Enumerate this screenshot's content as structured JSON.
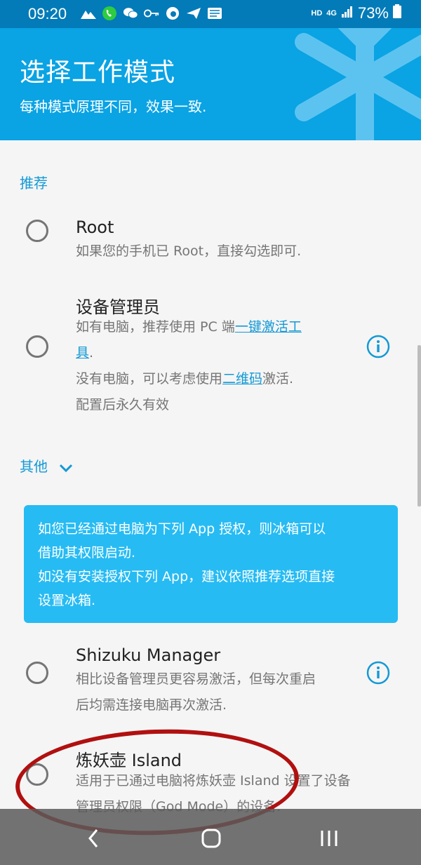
{
  "status_bar": {
    "time": "09:20",
    "hd": "HD",
    "network": "4G",
    "battery": "73%"
  },
  "header": {
    "title": "选择工作模式",
    "subtitle": "每种模式原理不同，效果一致."
  },
  "recommended": {
    "label": "推荐",
    "options": [
      {
        "title": "Root",
        "desc": "如果您的手机已 Root，直接勾选即可."
      },
      {
        "title": "设备管理员",
        "desc_line1_prefix": "如有电脑，推荐使用 PC 端",
        "desc_line1_link": "一键激活工",
        "desc_line2_link": "具",
        "desc_line2_suffix": ".",
        "desc_line3_prefix": "没有电脑，可以考虑使用",
        "desc_line3_link": "二维码",
        "desc_line3_suffix": "激活.",
        "desc_line4": "配置后永久有效"
      }
    ]
  },
  "others": {
    "label": "其他",
    "info_box": {
      "line1": "如您已经通过电脑为下列 App 授权，则冰箱可以",
      "line2": "借助其权限启动.",
      "line3": "如没有安装授权下列 App，建议依照推荐选项直接",
      "line4": "设置冰箱."
    },
    "options": [
      {
        "title": "Shizuku Manager",
        "desc_line1": "相比设备管理员更容易激活，但每次重启",
        "desc_line2": "后均需连接电脑再次激活."
      },
      {
        "title": "炼妖壶 Island",
        "desc_line1": "适用于已通过电脑将炼妖壶 Island 设置了设备",
        "desc_line2": "管理员权限（God Mode）的设备."
      }
    ]
  },
  "colors": {
    "status_bar": "#027bb8",
    "header": "#0aa3e4",
    "accent": "#1399d6",
    "info_box": "#27bbf3",
    "annotation": "#b11010"
  }
}
